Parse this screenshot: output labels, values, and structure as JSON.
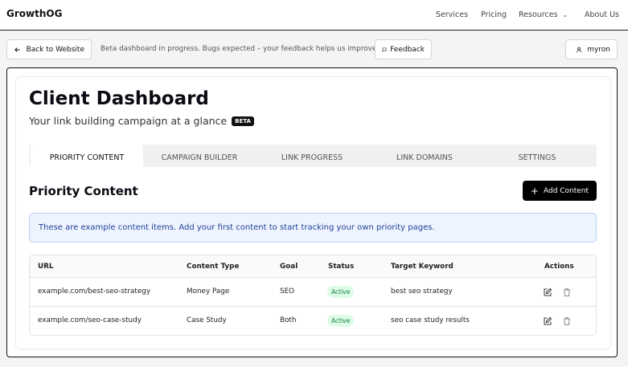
{
  "nav": {
    "brand": "GrowthOG",
    "links": [
      "Services",
      "Pricing",
      "Resources",
      "About Us"
    ]
  },
  "subbar": {
    "back_label": "Back to Website",
    "notice": "Beta dashboard in progress. Bugs expected – your feedback helps us improve",
    "feedback_label": "Feedback",
    "user_label": "myron"
  },
  "header": {
    "title": "Client Dashboard",
    "subtitle": "Your link building campaign at a glance",
    "badge": "BETA"
  },
  "tabs": [
    "PRIORITY CONTENT",
    "CAMPAIGN BUILDER",
    "LINK PROGRESS",
    "LINK DOMAINS",
    "SETTINGS"
  ],
  "section": {
    "title": "Priority Content",
    "add_label": "Add Content",
    "alert": "These are example content items. Add your first content to start tracking your own priority pages."
  },
  "table": {
    "columns": [
      "URL",
      "Content Type",
      "Goal",
      "Status",
      "Target Keyword",
      "Actions"
    ],
    "rows": [
      {
        "url": "example.com/best-seo-strategy",
        "type": "Money Page",
        "goal": "SEO",
        "status": "Active",
        "keyword": "best seo strategy"
      },
      {
        "url": "example.com/seo-case-study",
        "type": "Case Study",
        "goal": "Both",
        "status": "Active",
        "keyword": "seo case study results"
      }
    ]
  },
  "colors": {
    "accent": "#000000",
    "alert_bg": "#eef4fd",
    "alert_text": "#23419a",
    "status_active_bg": "#dcfce7",
    "status_active_text": "#15803d"
  },
  "icons": [
    "arrow-left-icon",
    "message-square-icon",
    "user-icon",
    "chevron-down-icon",
    "plus-icon",
    "edit-icon",
    "trash-icon"
  ]
}
